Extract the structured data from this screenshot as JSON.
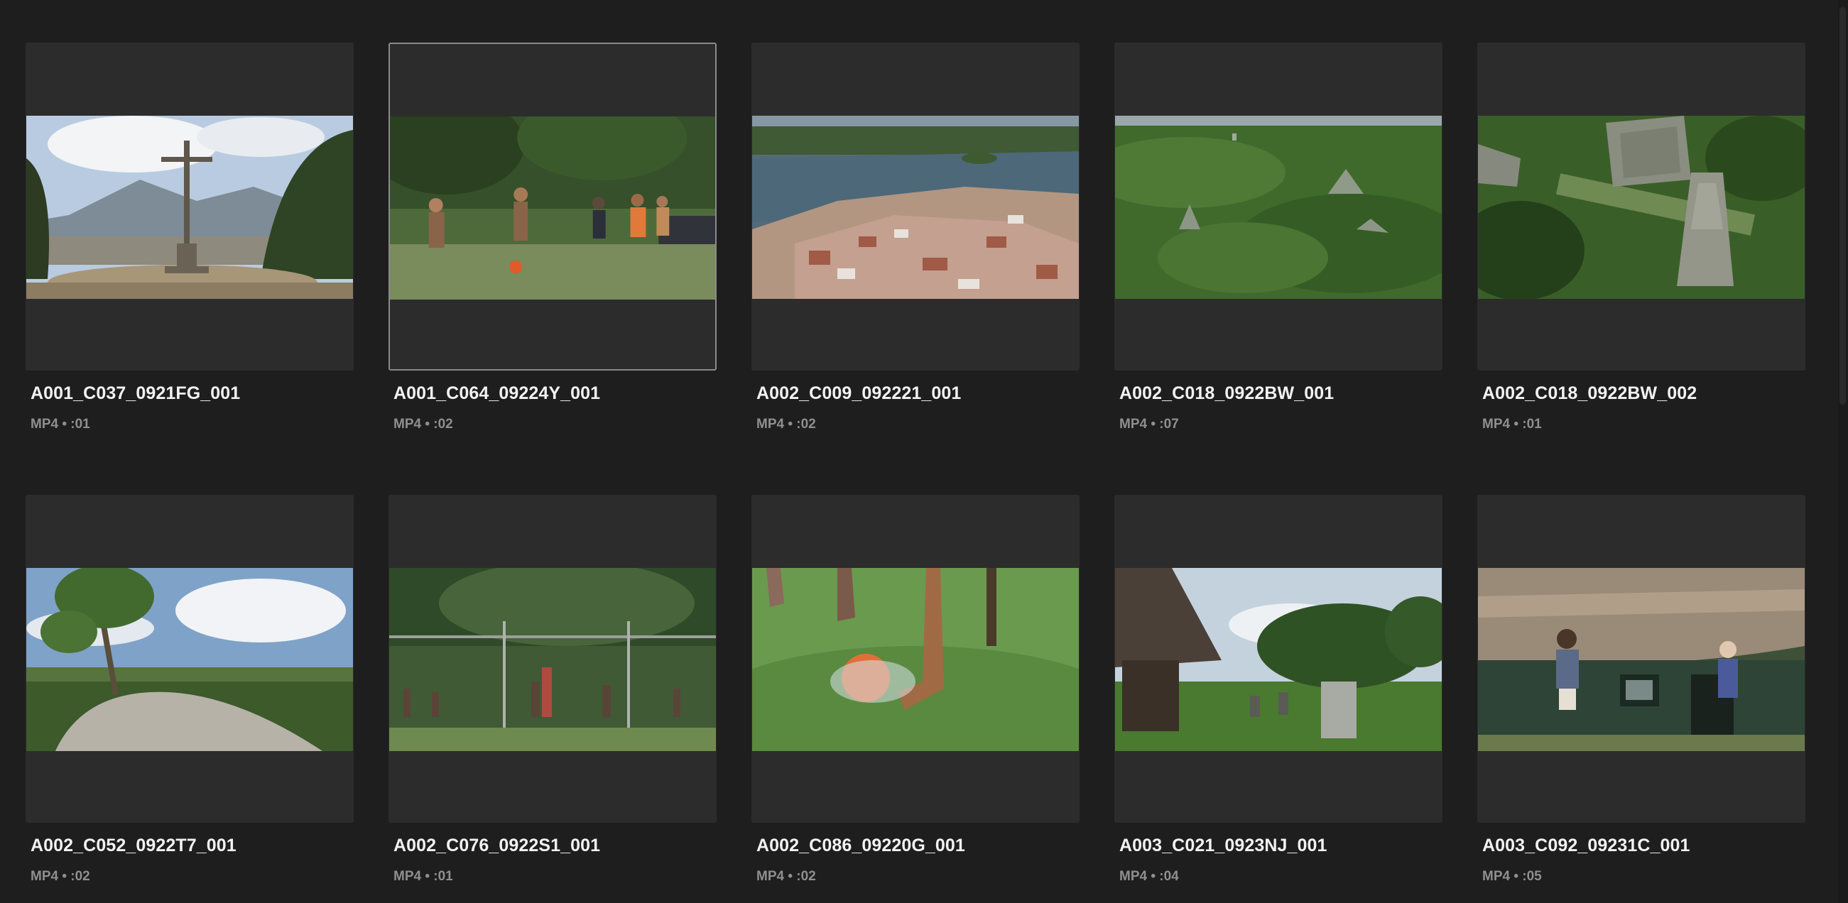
{
  "clips": [
    {
      "name": "A001_C037_0921FG_001",
      "meta": "MP4 • :01",
      "selected": false,
      "scene": "cross on hilltop"
    },
    {
      "name": "A001_C064_09224Y_001",
      "meta": "MP4 • :02",
      "selected": true,
      "scene": "boys playing soccer"
    },
    {
      "name": "A002_C009_092221_001",
      "meta": "MP4 • :02",
      "selected": false,
      "scene": "aerial island town"
    },
    {
      "name": "A002_C018_0922BW_001",
      "meta": "MP4 • :07",
      "selected": false,
      "scene": "aerial jungle temples"
    },
    {
      "name": "A002_C018_0922BW_002",
      "meta": "MP4 • :01",
      "selected": false,
      "scene": "aerial temple ruins"
    },
    {
      "name": "A002_C052_0922T7_001",
      "meta": "MP4 • :02",
      "selected": false,
      "scene": "tree on rock, cloudy sky"
    },
    {
      "name": "A002_C076_0922S1_001",
      "meta": "MP4 • :01",
      "selected": false,
      "scene": "soccer goal net"
    },
    {
      "name": "A002_C086_09220G_001",
      "meta": "MP4 • :02",
      "selected": false,
      "scene": "barefoot kicking ball"
    },
    {
      "name": "A003_C021_0923NJ_001",
      "meta": "MP4 • :04",
      "selected": false,
      "scene": "thatched hut and stelae"
    },
    {
      "name": "A003_C092_09231C_001",
      "meta": "MP4 • :05",
      "selected": false,
      "scene": "children running by hut"
    }
  ]
}
